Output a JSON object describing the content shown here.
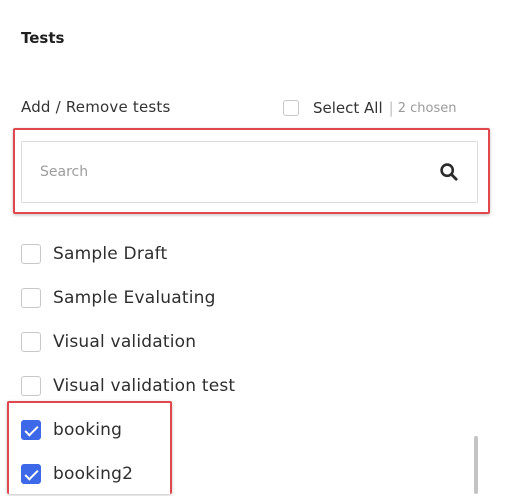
{
  "section": {
    "title": "Tests"
  },
  "header": {
    "label": "Add / Remove tests",
    "select_all_label": "Select All",
    "separator": "|",
    "chosen_text": "2 chosen",
    "select_all_checked": false
  },
  "search": {
    "placeholder": "Search",
    "value": "",
    "icon": "search-icon"
  },
  "tests": [
    {
      "label": "Sample Draft",
      "checked": false
    },
    {
      "label": "Sample Evaluating",
      "checked": false
    },
    {
      "label": "Visual validation",
      "checked": false
    },
    {
      "label": "Visual validation test",
      "checked": false
    },
    {
      "label": "booking",
      "checked": true
    },
    {
      "label": "booking2",
      "checked": true
    }
  ],
  "colors": {
    "accent": "#3d68e8",
    "highlight": "#e0484e"
  }
}
